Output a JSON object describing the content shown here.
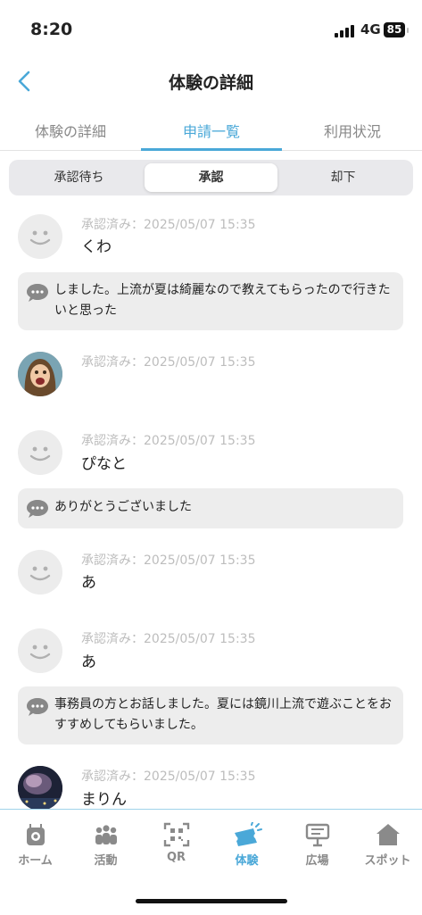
{
  "status": {
    "time": "8:20",
    "network": "4G",
    "battery": "85"
  },
  "header": {
    "title": "体験の詳細"
  },
  "tabs": [
    {
      "label": "体験の詳細"
    },
    {
      "label": "申請一覧"
    },
    {
      "label": "利用状況"
    }
  ],
  "segments": [
    {
      "label": "承認待ち"
    },
    {
      "label": "承認"
    },
    {
      "label": "却下"
    }
  ],
  "entries": [
    {
      "status": "承認済み：2025/05/07 15:35",
      "name": "くわ",
      "message": "しました。上流が夏は綺麗なので教えてもらったので行きたいと思った"
    },
    {
      "status": "承認済み：2025/05/07 15:35",
      "name": "",
      "message": ""
    },
    {
      "status": "承認済み：2025/05/07 15:35",
      "name": "ぴなと",
      "message": "ありがとうございました"
    },
    {
      "status": "承認済み：2025/05/07 15:35",
      "name": "あ",
      "message": ""
    },
    {
      "status": "承認済み：2025/05/07 15:35",
      "name": "あ",
      "message": "事務員の方とお話しました。夏には鏡川上流で遊ぶことをおすすめしてもらいました。"
    },
    {
      "status": "承認済み：2025/05/07 15:35",
      "name": "まりん",
      "message": ""
    }
  ],
  "tabbar": [
    {
      "label": "ホーム",
      "icon": "home-person-icon"
    },
    {
      "label": "活動",
      "icon": "people-icon"
    },
    {
      "label": "QR",
      "icon": "qr-icon"
    },
    {
      "label": "体験",
      "icon": "ticket-icon"
    },
    {
      "label": "広場",
      "icon": "signboard-icon"
    },
    {
      "label": "スポット",
      "icon": "house-icon"
    }
  ],
  "colors": {
    "accent": "#4aa8d8"
  }
}
